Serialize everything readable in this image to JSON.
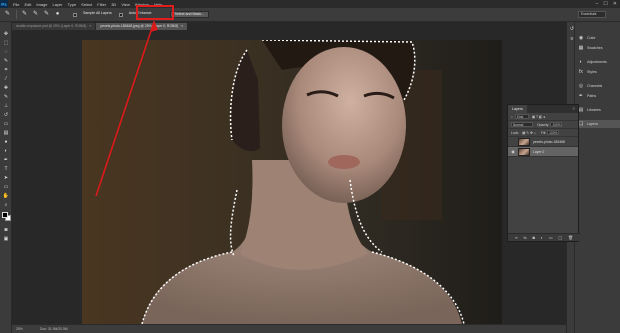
{
  "app": {
    "logo": "Ps"
  },
  "menu": [
    "File",
    "Edit",
    "Image",
    "Layer",
    "Type",
    "Select",
    "Filter",
    "3D",
    "View",
    "Window",
    "Help"
  ],
  "window_controls": [
    "–",
    "☐",
    "✕"
  ],
  "options_bar": {
    "sample_all_layers": "Sample All Layers",
    "auto_enhance": "Auto-Enhance",
    "select_and_mask": "Select and Mask...",
    "workspace": "Essentials"
  },
  "tabs": [
    {
      "label": "double-exposure.psd @ 25% (Layer 0, RGB/8)",
      "close": "×"
    },
    {
      "label": "pexels-photo-185468.jpeg @ 25% (Layer 0, RGB/8)",
      "close": "×"
    }
  ],
  "status": {
    "zoom": "25%",
    "doc_info": "Doc: 31.9M/20.9M"
  },
  "side_panels": [
    {
      "label": "Color",
      "icon": "color-icon"
    },
    {
      "label": "Swatches",
      "icon": "swatches-icon"
    },
    {
      "label": "Adjustments",
      "icon": "adjustments-icon"
    },
    {
      "label": "Styles",
      "icon": "styles-icon"
    },
    {
      "label": "Channels",
      "icon": "channels-icon"
    },
    {
      "label": "Paths",
      "icon": "paths-icon"
    },
    {
      "label": "Libraries",
      "icon": "libraries-icon"
    },
    {
      "label": "Layers",
      "icon": "layers-icon"
    }
  ],
  "layers_panel": {
    "tab": "Layers",
    "kind": "Kind",
    "blend_mode": "Normal",
    "opacity_label": "Opacity:",
    "opacity": "100%",
    "lock_label": "Lock:",
    "fill_label": "Fill:",
    "fill": "100%",
    "layers": [
      {
        "name": "pexels-photo-185468",
        "visible": false,
        "selected": false
      },
      {
        "name": "Layer 0",
        "visible": true,
        "selected": true
      }
    ]
  },
  "colors": {
    "highlight": "#e01e1e",
    "arrow": "#d81a1a"
  }
}
